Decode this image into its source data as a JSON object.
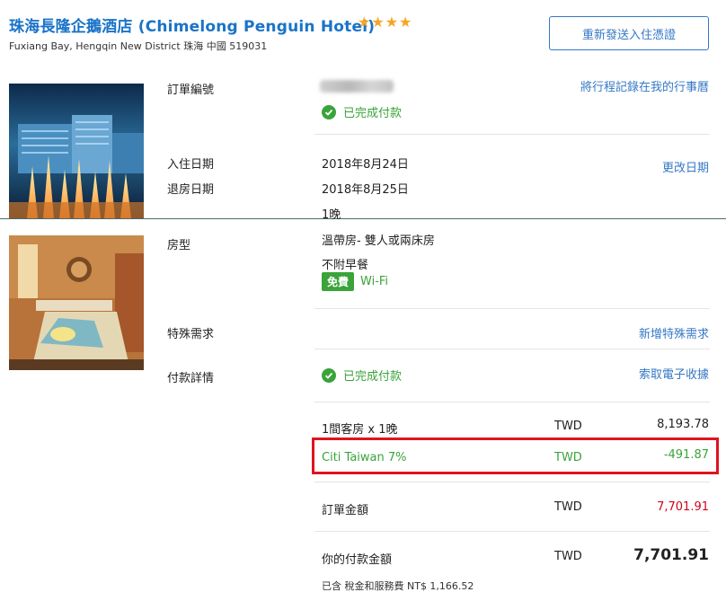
{
  "header": {
    "hotel_name": "珠海長隆企鵝酒店 (Chimelong Penguin Hotel)",
    "stars": "★★★★",
    "address": "Fuxiang Bay, Hengqin New District 珠海 中國 519031",
    "resend_button": "重新發送入住憑證"
  },
  "booking": {
    "order_label": "訂單編號",
    "payment_status": "已完成付款",
    "add_calendar_link": "將行程記錄在我的行事曆",
    "checkin_label": "入住日期",
    "checkin_value": "2018年8月24日",
    "checkout_label": "退房日期",
    "checkout_value": "2018年8月25日",
    "nights": "1晚",
    "change_date_link": "更改日期"
  },
  "room": {
    "label": "房型",
    "type": "溫帶房- 雙人或兩床房",
    "breakfast": "不附早餐",
    "free_badge": "免費",
    "wifi_label": "Wi-Fi"
  },
  "special_requests": {
    "label": "特殊需求",
    "link": "新增特殊需求"
  },
  "payment": {
    "label": "付款詳情",
    "status": "已完成付款",
    "receipt_link": "索取電子收據",
    "lines": [
      {
        "desc": "1間客房 x 1晚",
        "currency": "TWD",
        "amount": "8,193.78"
      },
      {
        "desc": "Citi Taiwan 7%",
        "currency": "TWD",
        "amount": "-491.87"
      }
    ],
    "order_total_label": "訂單金額",
    "order_total_currency": "TWD",
    "order_total_amount": "7,701.91",
    "your_payment_label": "你的付款金額",
    "your_payment_currency": "TWD",
    "your_payment_amount": "7,701.91",
    "tax_note": "已含 稅金和服務費 NT$ 1,166.52"
  },
  "colors": {
    "brand_blue": "#1a73c8",
    "link_blue": "#3578c6",
    "success_green": "#3aa33a",
    "price_red": "#d0021b",
    "highlight_red": "#e0141e",
    "star_gold": "#f5a623"
  }
}
